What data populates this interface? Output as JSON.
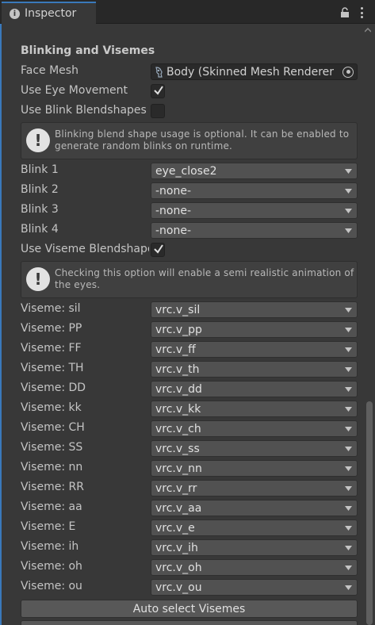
{
  "tab": {
    "title": "Inspector",
    "icon": "info-icon"
  },
  "toolbar": {
    "lock_icon": "lock-icon",
    "menu_icon": "kebab-icon"
  },
  "section": {
    "title": "Blinking and Visemes"
  },
  "face_mesh": {
    "label": "Face Mesh",
    "value": "Body (Skinned Mesh Renderer",
    "icon": "skinned-mesh-icon"
  },
  "eye_movement": {
    "label": "Use Eye Movement",
    "checked": true
  },
  "blink_blendshapes": {
    "label": "Use Blink Blendshapes",
    "checked": false
  },
  "blink_help": {
    "text": "Blinking blend shape usage is optional. It can be enabled to generate random blinks on runtime."
  },
  "blinks": [
    {
      "label": "Blink 1",
      "value": "eye_close2"
    },
    {
      "label": "Blink 2",
      "value": "-none-"
    },
    {
      "label": "Blink 3",
      "value": "-none-"
    },
    {
      "label": "Blink 4",
      "value": "-none-"
    }
  ],
  "viseme_blendshapes": {
    "label": "Use Viseme Blendshapes",
    "checked": true
  },
  "viseme_help": {
    "text": "Checking this option will enable a semi realistic animation of the eyes."
  },
  "visemes": [
    {
      "label": "Viseme: sil",
      "value": "vrc.v_sil"
    },
    {
      "label": "Viseme: PP",
      "value": "vrc.v_pp"
    },
    {
      "label": "Viseme: FF",
      "value": "vrc.v_ff"
    },
    {
      "label": "Viseme: TH",
      "value": "vrc.v_th"
    },
    {
      "label": "Viseme: DD",
      "value": "vrc.v_dd"
    },
    {
      "label": "Viseme: kk",
      "value": "vrc.v_kk"
    },
    {
      "label": "Viseme: CH",
      "value": "vrc.v_ch"
    },
    {
      "label": "Viseme: SS",
      "value": "vrc.v_ss"
    },
    {
      "label": "Viseme: nn",
      "value": "vrc.v_nn"
    },
    {
      "label": "Viseme: RR",
      "value": "vrc.v_rr"
    },
    {
      "label": "Viseme: aa",
      "value": "vrc.v_aa"
    },
    {
      "label": "Viseme: E",
      "value": "vrc.v_e"
    },
    {
      "label": "Viseme: ih",
      "value": "vrc.v_ih"
    },
    {
      "label": "Viseme: oh",
      "value": "vrc.v_oh"
    },
    {
      "label": "Viseme: ou",
      "value": "vrc.v_ou"
    }
  ],
  "auto_select": {
    "label": "Auto select Visemes"
  },
  "colors": {
    "accent": "#3a79bb",
    "panel": "#383838",
    "field": "#515151"
  }
}
